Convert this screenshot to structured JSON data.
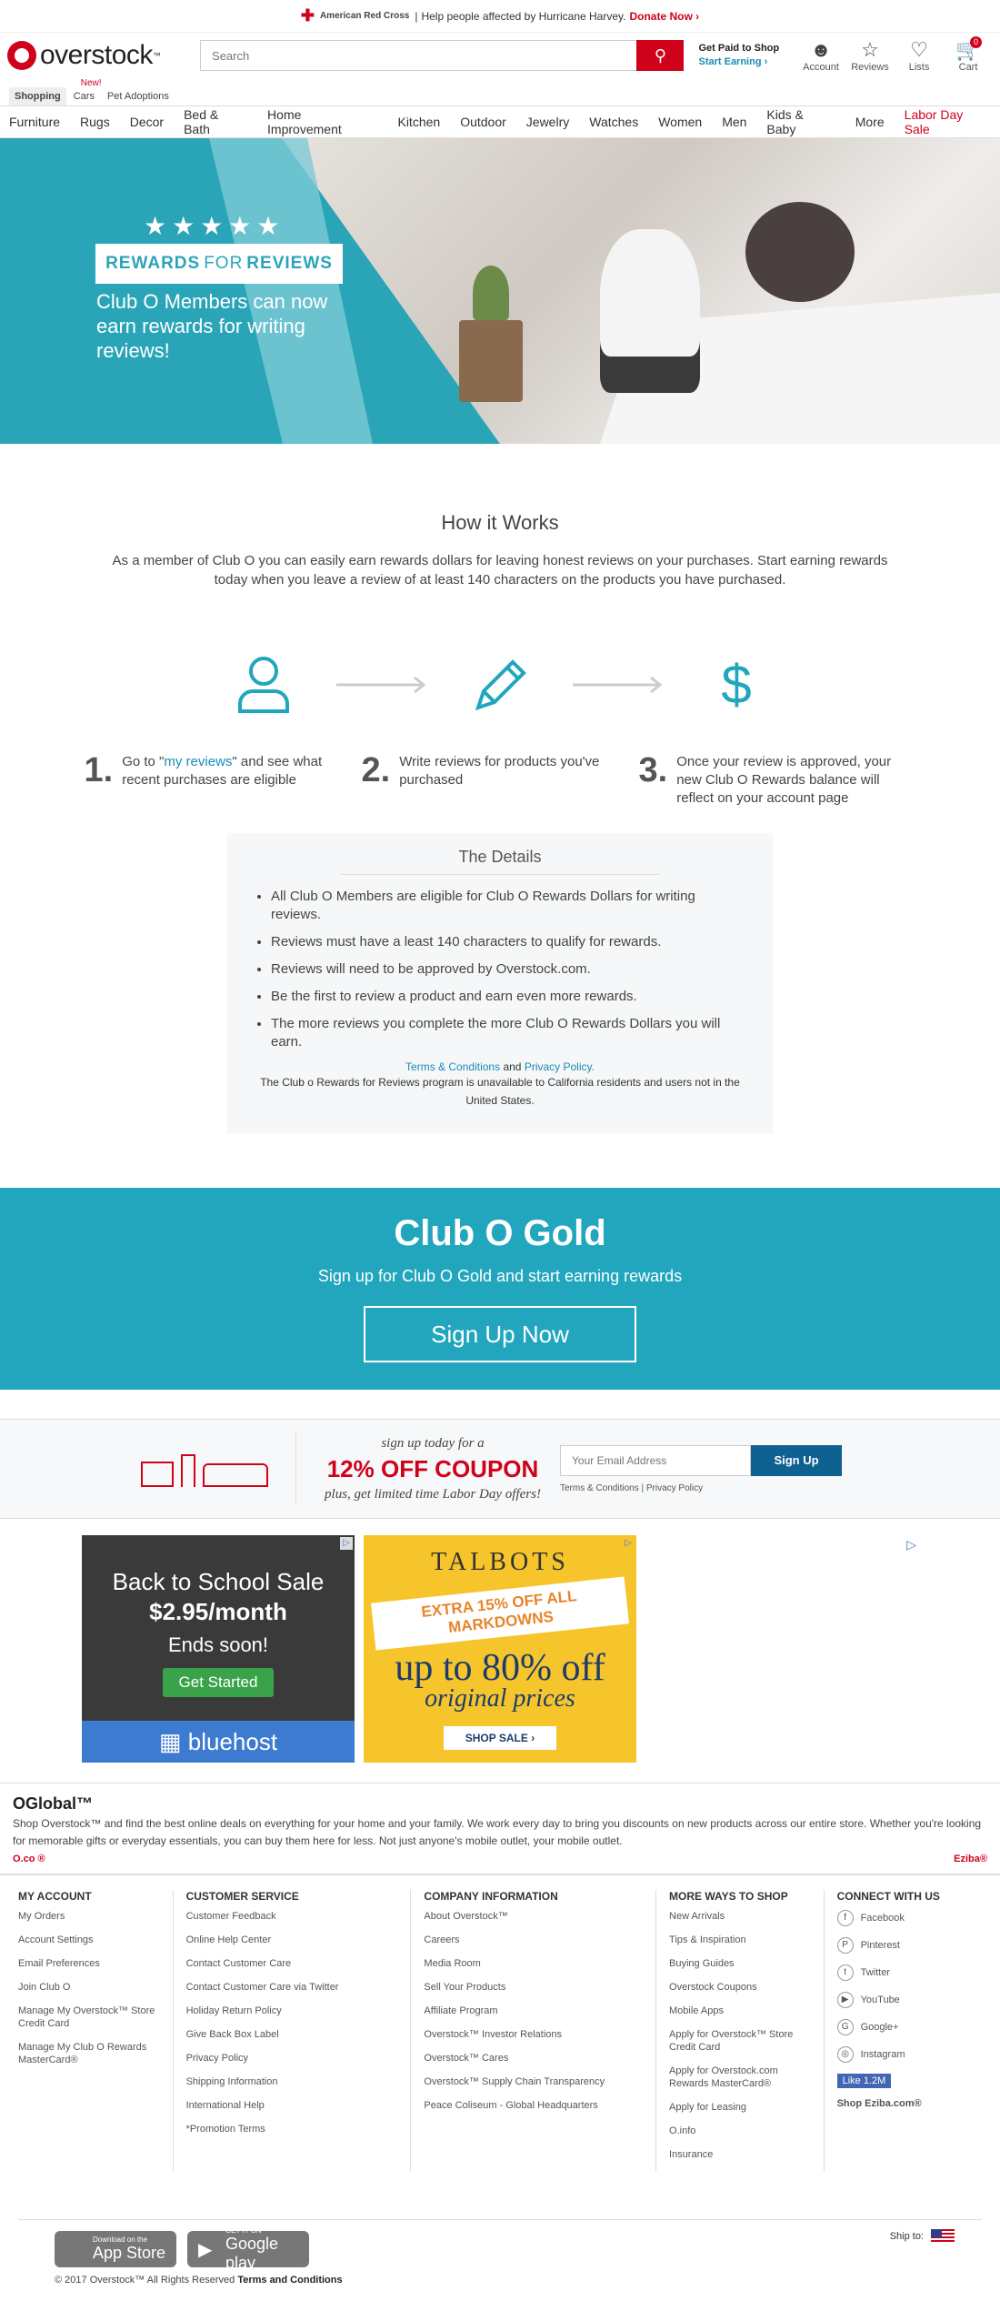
{
  "topbar": {
    "org": "American Red Cross",
    "message": "Help people affected by Hurricane Harvey.",
    "donate": "Donate Now ›"
  },
  "header": {
    "logo": "overstock",
    "search_placeholder": "Search",
    "paid_title": "Get Paid to Shop",
    "paid_link": "Start Earning ›",
    "account": "Account",
    "reviews": "Reviews",
    "lists": "Lists",
    "cart": "Cart",
    "cart_count": "0"
  },
  "subtabs": {
    "shopping": "Shopping",
    "new": "New!",
    "cars": "Cars",
    "pets": "Pet Adoptions"
  },
  "nav": [
    "Furniture",
    "Rugs",
    "Decor",
    "Bed & Bath",
    "Home Improvement",
    "Kitchen",
    "Outdoor",
    "Jewelry",
    "Watches",
    "Women",
    "Men",
    "Kids & Baby",
    "More"
  ],
  "nav_sale": "Labor Day Sale",
  "hero": {
    "stars": "★★★★★",
    "badge_a": "REWARDS",
    "badge_b": "FOR",
    "badge_c": "REVIEWS",
    "sub": "Club O Members can now earn rewards for writing reviews!"
  },
  "how": {
    "title": "How it Works",
    "intro": "As a member of Club O you can easily earn rewards dollars for leaving honest reviews on your purchases. Start earning rewards today when you leave a review of at least 140 characters on the products you have purchased.",
    "step1_num": "1.",
    "step1_pre": "Go to \"",
    "step1_link": "my reviews",
    "step1_post": "\" and see what recent purchases are eligible",
    "step2_num": "2.",
    "step2": "Write reviews for products you've purchased",
    "step3_num": "3.",
    "step3": "Once your review is approved, your new Club O Rewards balance will reflect on your account page"
  },
  "details": {
    "title": "The Details",
    "items": [
      "All Club O Members are eligible for Club O Rewards Dollars for writing reviews.",
      "Reviews must have a least 140 characters to qualify for rewards.",
      "Reviews will need to be approved by Overstock.com.",
      "Be the first to review a product and earn even more rewards.",
      "The more reviews you complete the more Club O Rewards Dollars you will earn."
    ],
    "terms": "Terms & Conditions",
    "and": "and",
    "privacy": "Privacy Policy.",
    "note": "The Club o Rewards for Reviews program is unavailable to California residents and users not in the United States."
  },
  "gold": {
    "title": "Club O Gold",
    "subtitle": "Sign up for Club O Gold and start earning rewards",
    "button": "Sign Up Now"
  },
  "coupon": {
    "line1": "sign up today for a",
    "big": "12% OFF COUPON",
    "line2": "plus, get limited time Labor Day offers!",
    "placeholder": "Your Email Address",
    "button": "Sign Up",
    "terms": "Terms & Conditions",
    "privacy": "Privacy Policy"
  },
  "ad1": {
    "t1": "Back to School Sale",
    "t2": "$2.95/month",
    "t3": "Ends soon!",
    "btn": "Get Started",
    "brand": "bluehost"
  },
  "ad2": {
    "brand": "TALBOTS",
    "band": "EXTRA 15% OFF ALL MARKDOWNS",
    "upto": "up to 80% off",
    "orig": "original prices",
    "shop": "SHOP SALE ›"
  },
  "oglobal": {
    "title": "OGlobal™",
    "text": "Shop Overstock™ and find the best online deals on everything for your home and your family. We work every day to bring you discounts on new products across our entire store. Whether you're looking for memorable gifts or everyday essentials, you can buy them here for less. Not just anyone's mobile outlet, your mobile outlet.",
    "left": "O.co ®",
    "right": "Eziba®"
  },
  "footer": {
    "account": {
      "title": "MY ACCOUNT",
      "links": [
        "My Orders",
        "Account Settings",
        "Email Preferences",
        "Join Club O",
        "Manage My Overstock™ Store Credit Card",
        "Manage My Club O Rewards MasterCard®"
      ]
    },
    "service": {
      "title": "CUSTOMER SERVICE",
      "links": [
        "Customer Feedback",
        "Online Help Center",
        "Contact Customer Care",
        "Contact Customer Care via Twitter",
        "Holiday Return Policy",
        "Give Back Box Label",
        "Privacy Policy",
        "Shipping Information",
        "International Help",
        "*Promotion Terms"
      ]
    },
    "company": {
      "title": "COMPANY INFORMATION",
      "links": [
        "About Overstock™",
        "Careers",
        "Media Room",
        "Sell Your Products",
        "Affiliate Program",
        "Overstock™ Investor Relations",
        "Overstock™ Cares",
        "Overstock™ Supply Chain Transparency",
        "Peace Coliseum - Global Headquarters"
      ]
    },
    "more": {
      "title": "MORE WAYS TO SHOP",
      "links": [
        "New Arrivals",
        "Tips & Inspiration",
        "Buying Guides",
        "Overstock Coupons",
        "Mobile Apps",
        "Apply for Overstock™ Store Credit Card",
        "Apply for Overstock.com Rewards MasterCard®",
        "Apply for Leasing",
        "O.info",
        "Insurance"
      ]
    },
    "connect": {
      "title": "CONNECT WITH US",
      "links": [
        "Facebook",
        "Pinterest",
        "Twitter",
        "YouTube",
        "Google+",
        "Instagram"
      ],
      "like": "Like 1.2M",
      "eziba": "Shop Eziba.com®"
    }
  },
  "bottom": {
    "appstore_small": "Download on the",
    "appstore": "App Store",
    "gplay_small": "GET IT ON",
    "gplay": "Google play",
    "shipto": "Ship to:",
    "copyright": "© 2017 Overstock™ All Rights Reserved",
    "terms": "Terms and Conditions"
  }
}
